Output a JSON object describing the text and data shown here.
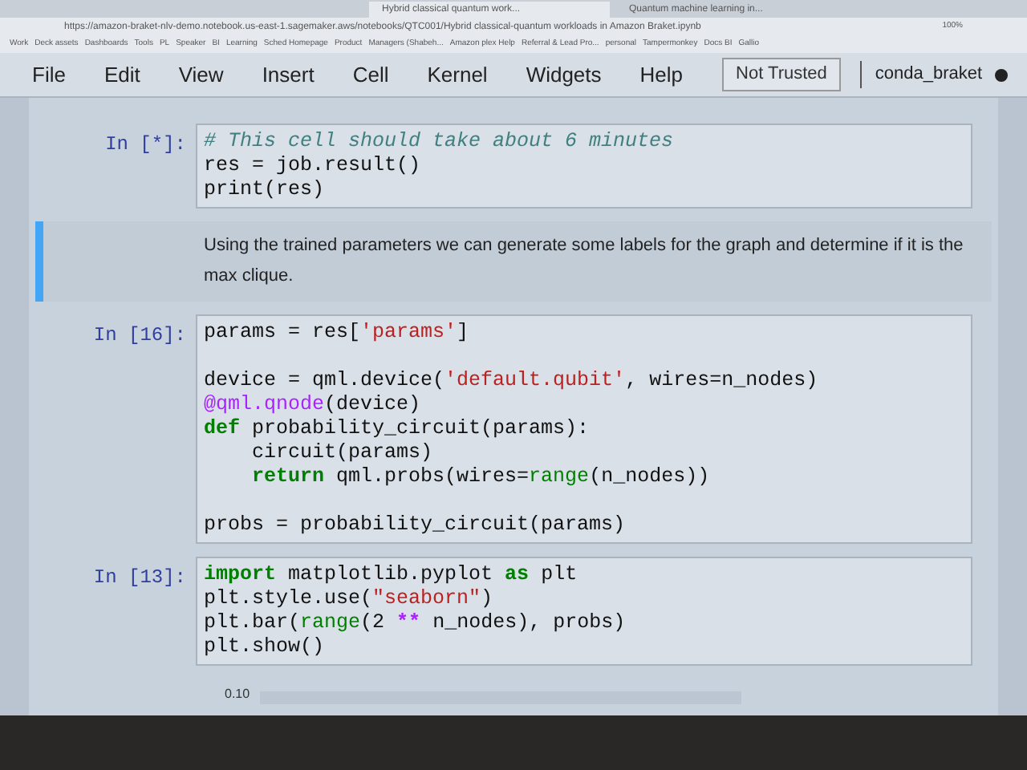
{
  "browser": {
    "tabs": [
      {
        "title": "Hybrid classical quantum work...",
        "selected": true
      },
      {
        "title": "Quantum machine learning in...",
        "selected": false
      }
    ],
    "url": "https://amazon-braket-nlv-demo.notebook.us-east-1.sagemaker.aws/notebooks/QTC001/Hybrid classical-quantum workloads in Amazon Braket.ipynb",
    "zoom": "100%",
    "bookmarks": [
      "Work",
      "Deck assets",
      "Dashboards",
      "Tools",
      "PL",
      "Speaker",
      "BI",
      "Learning",
      "Sched Homepage",
      "Product",
      "Managers (Shabeh...",
      "Amazon plex Help",
      "Referral & Lead Pro...",
      "personal",
      "Tampermonkey",
      "Docs BI",
      "Gallio"
    ]
  },
  "menu": [
    "File",
    "Edit",
    "View",
    "Insert",
    "Cell",
    "Kernel",
    "Widgets",
    "Help"
  ],
  "trust": "Not Trusted",
  "kernel": {
    "name": "conda_braket",
    "busy": true
  },
  "cells": [
    {
      "kind": "code",
      "prompt": "In [*]:",
      "lines": [
        {
          "kind": "code",
          "indented": false,
          "tokens": [
            {
              "text": "# This cell should take about 6 minutes",
              "kind": "comment"
            }
          ]
        },
        {
          "kind": "code",
          "indented": false,
          "tokens": [
            {
              "text": "res = job.result()",
              "kind": "plain"
            }
          ]
        },
        {
          "kind": "code",
          "indented": false,
          "tokens": [
            {
              "text": "print(res)",
              "kind": "plain"
            }
          ]
        }
      ]
    },
    {
      "kind": "markdown",
      "selected": true,
      "text": "Using the trained parameters we can generate some labels for the graph and determine if it is the max clique."
    },
    {
      "kind": "code",
      "prompt": "In [16]:",
      "lines": [
        {
          "kind": "code",
          "indented": false,
          "tokens": [
            {
              "text": "params = res[",
              "kind": "plain"
            },
            {
              "text": "'params'",
              "kind": "string"
            },
            {
              "text": "]",
              "kind": "plain"
            }
          ]
        },
        {
          "kind": "blank"
        },
        {
          "kind": "code",
          "indented": false,
          "tokens": [
            {
              "text": "device = qml.device(",
              "kind": "plain"
            },
            {
              "text": "'default.qubit'",
              "kind": "string"
            },
            {
              "text": ", wires=n_nodes)",
              "kind": "plain"
            }
          ]
        },
        {
          "kind": "code",
          "indented": false,
          "tokens": [
            {
              "text": "@qml.qnode",
              "kind": "decorator"
            },
            {
              "text": "(device)",
              "kind": "plain"
            }
          ]
        },
        {
          "kind": "code",
          "indented": false,
          "tokens": [
            {
              "text": "def",
              "kind": "keyword"
            },
            {
              "text": " probability_circuit(params):",
              "kind": "plain"
            }
          ]
        },
        {
          "kind": "code",
          "indented": true,
          "tokens": [
            {
              "text": "circuit(params)",
              "kind": "plain"
            }
          ]
        },
        {
          "kind": "code",
          "indented": true,
          "tokens": [
            {
              "text": "return",
              "kind": "keyword"
            },
            {
              "text": " qml.probs(wires=",
              "kind": "plain"
            },
            {
              "text": "range",
              "kind": "builtin"
            },
            {
              "text": "(n_nodes))",
              "kind": "plain"
            }
          ]
        },
        {
          "kind": "blank"
        },
        {
          "kind": "code",
          "indented": false,
          "tokens": [
            {
              "text": "probs = probability_circuit(params)",
              "kind": "plain"
            }
          ]
        }
      ]
    },
    {
      "kind": "code",
      "prompt": "In [13]:",
      "lines": [
        {
          "kind": "code",
          "indented": false,
          "tokens": [
            {
              "text": "import",
              "kind": "keyword"
            },
            {
              "text": " matplotlib.pyplot ",
              "kind": "plain"
            },
            {
              "text": "as",
              "kind": "keyword"
            },
            {
              "text": " plt",
              "kind": "plain"
            }
          ]
        },
        {
          "kind": "code",
          "indented": false,
          "tokens": [
            {
              "text": "plt.style.use(",
              "kind": "plain"
            },
            {
              "text": "\"seaborn\"",
              "kind": "string"
            },
            {
              "text": ")",
              "kind": "plain"
            }
          ]
        },
        {
          "kind": "code",
          "indented": false,
          "tokens": [
            {
              "text": "plt.bar(",
              "kind": "plain"
            },
            {
              "text": "range",
              "kind": "builtin"
            },
            {
              "text": "(2 ",
              "kind": "plain"
            },
            {
              "text": "**",
              "kind": "operator"
            },
            {
              "text": " n_nodes), probs)",
              "kind": "plain"
            }
          ]
        },
        {
          "kind": "code",
          "indented": false,
          "tokens": [
            {
              "text": "plt.show()",
              "kind": "plain"
            }
          ]
        }
      ]
    },
    {
      "kind": "output",
      "tick": "0.10"
    }
  ]
}
